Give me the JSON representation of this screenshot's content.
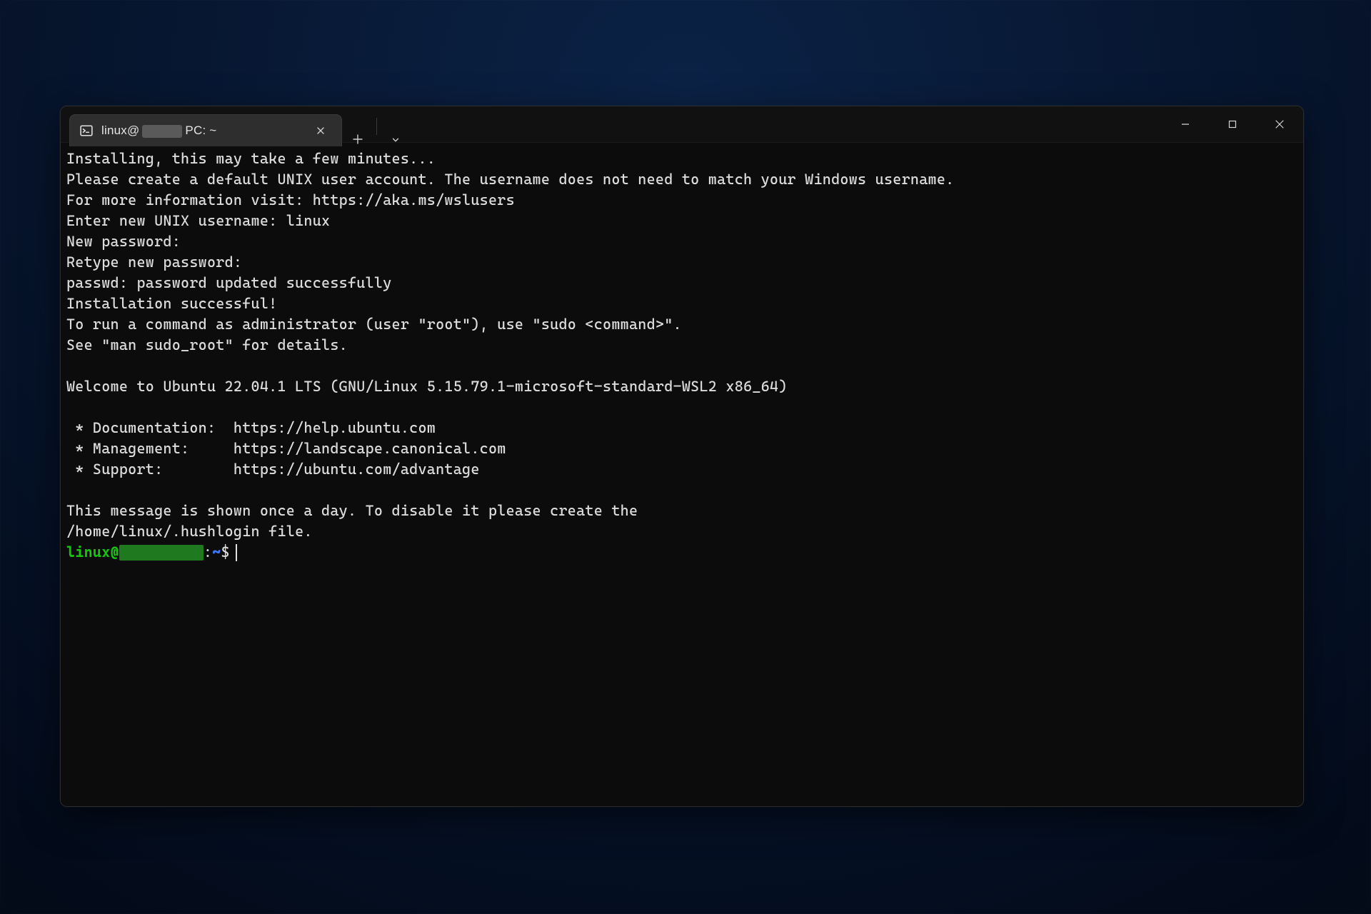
{
  "tab": {
    "title_prefix": "linux@",
    "title_suffix": "PC: ~"
  },
  "terminal": {
    "lines": [
      "Installing, this may take a few minutes...",
      "Please create a default UNIX user account. The username does not need to match your Windows username.",
      "For more information visit: https://aka.ms/wslusers",
      "Enter new UNIX username: linux",
      "New password:",
      "Retype new password:",
      "passwd: password updated successfully",
      "Installation successful!",
      "To run a command as administrator (user \"root\"), use \"sudo <command>\".",
      "See \"man sudo_root\" for details.",
      "",
      "Welcome to Ubuntu 22.04.1 LTS (GNU/Linux 5.15.79.1-microsoft-standard-WSL2 x86_64)",
      "",
      " * Documentation:  https://help.ubuntu.com",
      " * Management:     https://landscape.canonical.com",
      " * Support:        https://ubuntu.com/advantage",
      "",
      "This message is shown once a day. To disable it please create the",
      "/home/linux/.hushlogin file."
    ],
    "prompt": {
      "user_at": "linux@",
      "path_sep": ":",
      "path": "~",
      "symbol": "$"
    }
  }
}
